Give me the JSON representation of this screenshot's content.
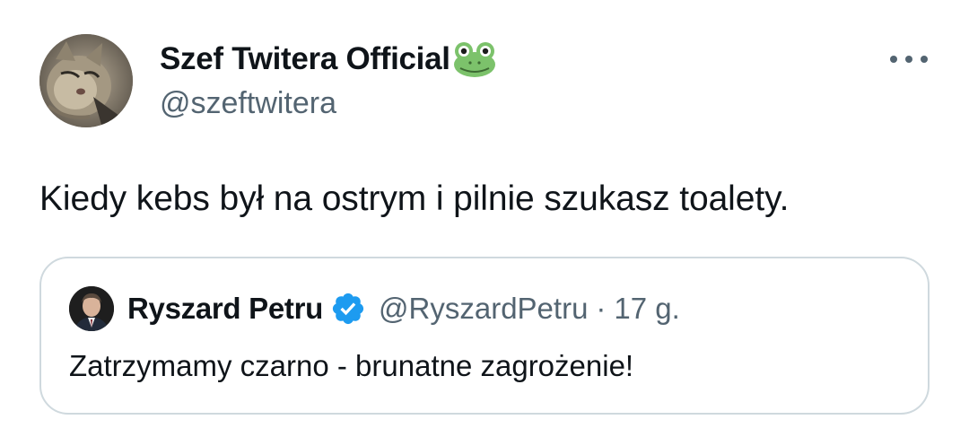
{
  "author": {
    "display_name": "Szef Twitera Official",
    "handle": "@szeftwitera",
    "name_emoji": "frog-face-icon",
    "avatar": "cat-avatar"
  },
  "tweet": {
    "text": "Kiedy kebs był na ostrym i pilnie szukasz toalety."
  },
  "quoted_tweet": {
    "display_name": "Ryszard Petru",
    "verified": true,
    "handle": "@RyszardPetru",
    "separator": "·",
    "time": "17 g.",
    "text": "Zatrzymamy czarno - brunatne zagrożenie!",
    "avatar": "man-portrait-avatar"
  },
  "colors": {
    "text_primary": "#0f1419",
    "text_secondary": "#536471",
    "border": "#cfd9de",
    "verified_blue": "#1d9bf0",
    "frog_green": "#7cc26b"
  },
  "icons": {
    "more": "more-horizontal-icon",
    "verified": "verified-badge-icon"
  }
}
